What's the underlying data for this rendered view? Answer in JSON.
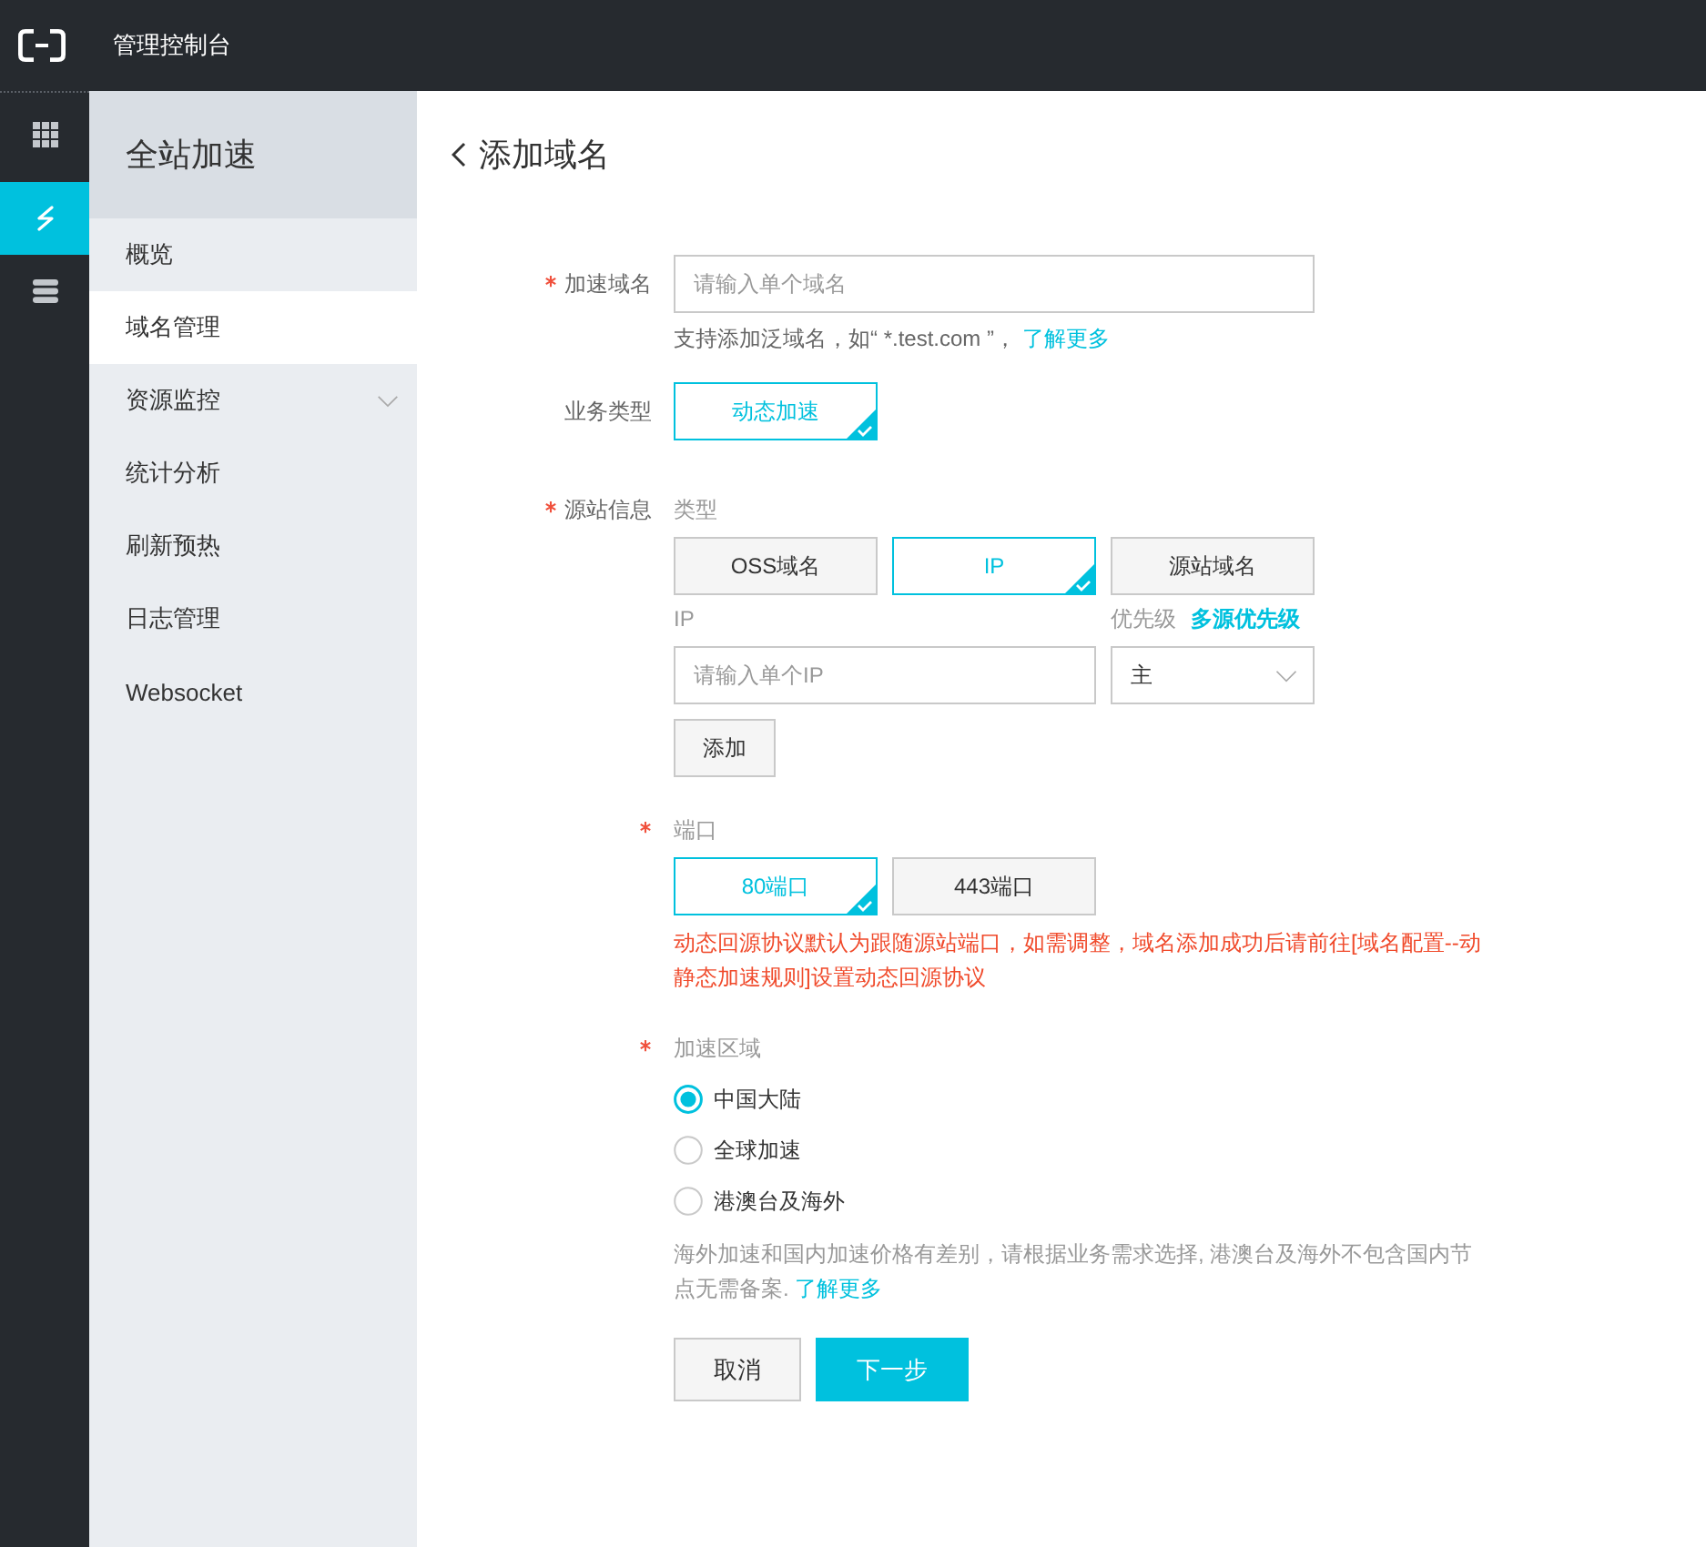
{
  "topbar": {
    "title": "管理控制台"
  },
  "icon_rail": [
    {
      "selected": false
    },
    {
      "selected": true
    },
    {
      "selected": false
    }
  ],
  "sidebar": {
    "title": "全站加速",
    "items": [
      {
        "label": "概览",
        "kind": "link",
        "selected": false
      },
      {
        "label": "域名管理",
        "kind": "link",
        "selected": true
      },
      {
        "label": "资源监控",
        "kind": "submenu",
        "selected": false
      },
      {
        "label": "统计分析",
        "kind": "link",
        "selected": false
      },
      {
        "label": "刷新预热",
        "kind": "link",
        "selected": false
      },
      {
        "label": "日志管理",
        "kind": "link",
        "selected": false
      },
      {
        "label": "Websocket",
        "kind": "link",
        "selected": false
      }
    ]
  },
  "page": {
    "title": "添加域名"
  },
  "form": {
    "domain": {
      "label": "加速域名",
      "required": true,
      "kind": "side",
      "placeholder": "请输入单个域名",
      "hint": "支持添加泛域名，如“ *.test.com ”，",
      "hint_link": "了解更多"
    },
    "business_type": {
      "label": "业务类型",
      "required": false,
      "kind": "side",
      "options": [
        {
          "label": "动态加速",
          "selected": true
        }
      ]
    },
    "origin": {
      "label": "源站信息",
      "required": true,
      "kind": "side",
      "type_label": "类型",
      "types": [
        {
          "label": "OSS域名",
          "selected": false
        },
        {
          "label": "IP",
          "selected": true
        },
        {
          "label": "源站域名",
          "selected": false
        }
      ],
      "ip_label": "IP",
      "ip_placeholder": "请输入单个IP",
      "priority_label": "优先级",
      "priority_link": "多源优先级",
      "priority_value": "主",
      "add_button": "添加"
    },
    "port": {
      "label": "端口",
      "required": true,
      "kind": "top",
      "options": [
        {
          "label": "80端口",
          "selected": true
        },
        {
          "label": "443端口",
          "selected": false
        }
      ],
      "warning": "动态回源协议默认为跟随源站端口，如需调整，域名添加成功后请前往[域名配置--动静态加速规则]设置动态回源协议"
    },
    "region": {
      "label": "加速区域",
      "required": true,
      "kind": "top",
      "options": [
        {
          "label": "中国大陆",
          "selected": true
        },
        {
          "label": "全球加速",
          "selected": false
        },
        {
          "label": "港澳台及海外",
          "selected": false
        }
      ],
      "note": "海外加速和国内加速价格有差别，请根据业务需求选择, 港澳台及海外不包含国内节点无需备案.",
      "note_link": "了解更多"
    },
    "buttons": [
      {
        "label": "取消",
        "kind": "secondary"
      },
      {
        "label": "下一步",
        "kind": "primary"
      }
    ]
  }
}
